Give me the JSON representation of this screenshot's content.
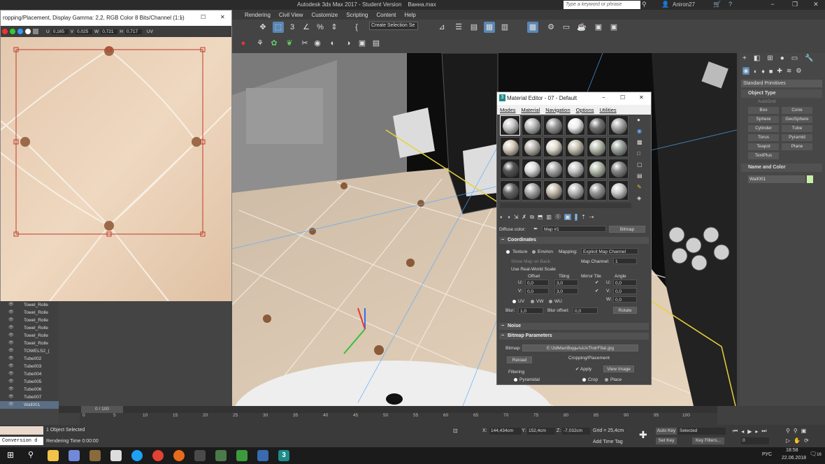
{
  "app": {
    "title": "Autodesk 3ds Max 2017 - Student Version",
    "file": "Ванна.max",
    "search_placeholder": "Type a keyword or phrase",
    "user": "Aniron27",
    "workspace": "Workspace: Default"
  },
  "menu": [
    "Rendering",
    "Civil View",
    "Customize",
    "Scripting",
    "Content",
    "Help"
  ],
  "toolbar": {
    "selection_set": "Create Selection Se"
  },
  "bitmap_window": {
    "title": "ropping/Placement, Display Gamma: 2,2, RGB Color 8 Bits/Channel (1:1)",
    "u_label": "U",
    "u_value": "0,165",
    "v_label": "V",
    "v_value": "0,025",
    "w_label": "W",
    "w_value": "0,721",
    "h_label": "H",
    "h_value": "0,717",
    "uv_label": "UV"
  },
  "scene_explorer": {
    "items": [
      "Towel_Rolle",
      "Towel_Rolle",
      "Towel_Rolle",
      "Towel_Rolle",
      "Towel_Rolle",
      "Towel_Rolle",
      "TOWELS2_(",
      "Tube002",
      "Tube003",
      "Tube004",
      "Tube005",
      "Tube006",
      "Tube007",
      "Wall001"
    ]
  },
  "material_editor": {
    "title": "Material Editor - 07 - Default",
    "menu": [
      "Modes",
      "Material",
      "Navigation",
      "Options",
      "Utilities"
    ],
    "diffuse_label": "Diffuse color:",
    "map_name": "Map #1",
    "map_type": "Bitmap",
    "coordinates": {
      "title": "Coordinates",
      "texture": "Texture",
      "environ": "Environ",
      "mapping_label": "Mapping:",
      "mapping_value": "Explicit Map Channel",
      "show_map_on_back": "Show Map on Back",
      "map_channel_label": "Map Channel:",
      "map_channel_value": "1",
      "use_real_world": "Use Real-World Scale",
      "offset": "Offset",
      "tiling": "Tiling",
      "mirror_tile": "Mirror Tile",
      "angle": "Angle",
      "u": "U:",
      "v": "V:",
      "w": "W:",
      "u_offset": "0,0",
      "v_offset": "0,0",
      "u_tiling": "3,0",
      "v_tiling": "3,0",
      "u_angle": "0,0",
      "v_angle": "0,0",
      "w_angle": "0,0",
      "uv": "UV",
      "vw": "VW",
      "wu": "WU",
      "blur_label": "Blur:",
      "blur_value": "1,0",
      "blur_offset_label": "Blur offset:",
      "blur_offset_value": "0,0",
      "rotate": "Rotate"
    },
    "noise": "Noise",
    "bitmap_params": {
      "title": "Bitmap Parameters",
      "bitmap_label": "Bitmap:",
      "bitmap_path": "E:\\3dMax\\Виды\\uUxThdrF9aI.jpg",
      "reload": "Reload",
      "cropping": "Cropping/Placement",
      "apply": "Apply",
      "view_image": "View Image",
      "filtering": "Filtering",
      "pyramidal": "Pyramidal",
      "crop": "Crop",
      "place": "Place"
    }
  },
  "command_panel": {
    "dropdown": "Standard Primitives",
    "object_type": "Object Type",
    "autogrid": "AutoGrid",
    "buttons": [
      "Box",
      "Cone",
      "Sphere",
      "GeoSphere",
      "Cylinder",
      "Tube",
      "Torus",
      "Pyramid",
      "Teapot",
      "Plane",
      "TextPlus"
    ],
    "name_and_color": "Name and Color",
    "object_name": "Wall001",
    "swatch_color": "#c9f0a8"
  },
  "timeline": {
    "slider": "0 / 100",
    "ticks": [
      "0",
      "5",
      "10",
      "15",
      "20",
      "25",
      "30",
      "35",
      "40",
      "45",
      "50",
      "55",
      "60",
      "65",
      "70",
      "75",
      "80",
      "85",
      "90",
      "95",
      "100"
    ]
  },
  "status": {
    "selected": "1 Object Selected",
    "render_time": "Rendering Time 0:00:00",
    "conversion": "Conversion d",
    "x_label": "X:",
    "x_value": "144,434cm",
    "y_label": "Y:",
    "y_value": "152,4cm",
    "z_label": "Z:",
    "z_value": "-7,032cm",
    "grid": "Grid = 25,4cm",
    "add_time_tag": "Add Time Tag",
    "auto_key": "Auto Key",
    "selected_dd": "Selected",
    "set_key": "Set Key",
    "key_filters": "Key Filters...",
    "frame": "0"
  },
  "taskbar": {
    "lang": "РУС",
    "time": "18:58",
    "date": "22.06.2018",
    "notif": "16"
  }
}
